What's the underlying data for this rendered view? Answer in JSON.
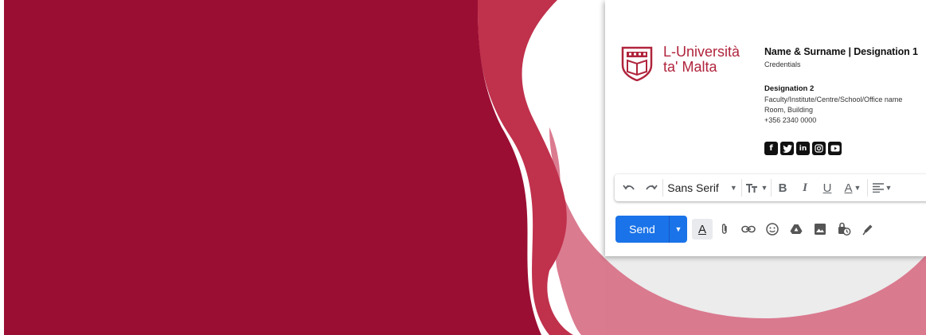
{
  "logo": {
    "line1": "L-Università",
    "line2": "ta' Malta"
  },
  "signature": {
    "name_line": "Name & Surname  |  Designation 1",
    "credentials": "Credentials",
    "designation2": "Designation 2",
    "office": "Faculty/Institute/Centre/School/Office name",
    "room": "Room, Building",
    "phone": "+356 2340 0000"
  },
  "social_icons": [
    "facebook-icon",
    "twitter-icon",
    "linkedin-icon",
    "instagram-icon",
    "youtube-icon"
  ],
  "toolbar": {
    "font_name": "Sans Serif"
  },
  "compose": {
    "send_label": "Send"
  },
  "colors": {
    "brand_red": "#9b0e33",
    "accent_red": "#c0314c",
    "pink": "#e0788a",
    "send_blue": "#1a73e8"
  }
}
